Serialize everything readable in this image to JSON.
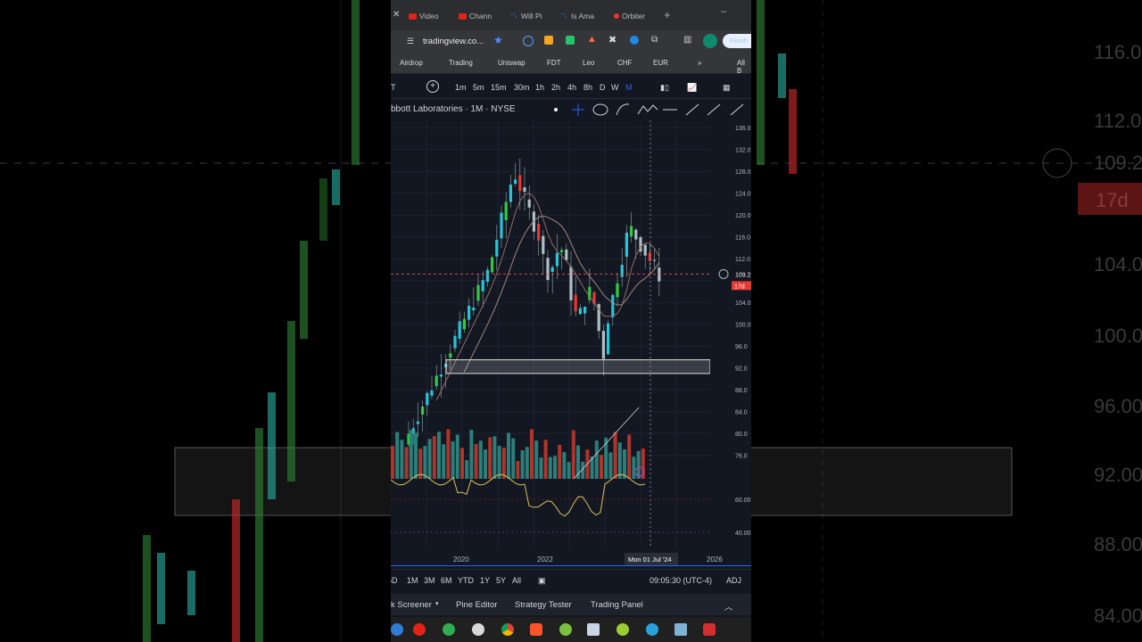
{
  "browser": {
    "tabs": [
      {
        "label": "Video",
        "kind": "yt"
      },
      {
        "label": "Chann",
        "kind": "yt"
      },
      {
        "label": "Will Pi",
        "kind": "tv"
      },
      {
        "label": "Is Ama",
        "kind": "tv"
      },
      {
        "label": "Orbiter",
        "kind": "other"
      }
    ],
    "address": "tradingview.co...",
    "finish_label": "Finish",
    "bookmarks": [
      "Airdrop",
      "Trading",
      "Uniswap",
      "FDT",
      "Leo",
      "CHF",
      "EUR"
    ],
    "bookmarks_all": "All B"
  },
  "toolbar": {
    "symbol_partial": "T",
    "intervals": [
      "1m",
      "5m",
      "15m",
      "30m",
      "1h",
      "2h",
      "4h",
      "8h",
      "D",
      "W",
      "M"
    ],
    "active_interval": "M"
  },
  "legend": {
    "title": "bbott Laboratories · 1M · NYSE"
  },
  "chart_data": {
    "type": "candlestick",
    "symbol": "Abbott Laboratories",
    "interval": "1M",
    "exchange": "NYSE",
    "yticks": [
      "136.0",
      "132.0",
      "128.0",
      "124.0",
      "120.0",
      "116.0",
      "112.0",
      "109.2",
      "104.0",
      "100.0",
      "96.0",
      "92.0",
      "88.0",
      "84.0",
      "80.0",
      "76.0"
    ],
    "ylim": [
      74,
      137
    ],
    "indicator_ticks": [
      "60.00",
      "40.00"
    ],
    "xticks": [
      "2020",
      "2022",
      "2026"
    ],
    "crosshair_x_label": "Mon 01 Jul '24",
    "last_price": "109.2",
    "countdown": "17d",
    "support_zone": [
      91.0,
      93.5
    ],
    "colors": {
      "up": "#26a69a",
      "down": "#ef5350",
      "bright_up": "#2ecc40",
      "rsi": "#e0c15a"
    }
  },
  "bottom": {
    "ranges": [
      "5D",
      "1M",
      "3M",
      "6M",
      "YTD",
      "1Y",
      "5Y",
      "All"
    ],
    "time": "09:05:30 (UTC-4)",
    "adj": "ADJ"
  },
  "panels": [
    "k Screener",
    "Pine Editor",
    "Strategy Tester",
    "Trading Panel"
  ],
  "background_right_ticks": [
    "116.0",
    "112.0",
    "109.2",
    "104.0",
    "100.0",
    "96.00",
    "92.00",
    "88.00",
    "84.00"
  ],
  "background_countdown": "17d"
}
